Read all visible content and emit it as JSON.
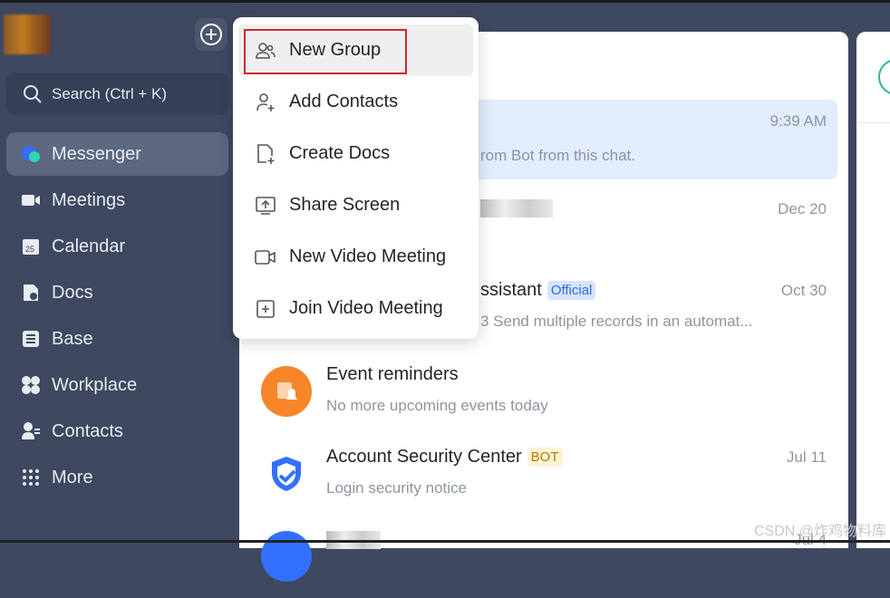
{
  "sidebar": {
    "search_placeholder": "Search (Ctrl + K)",
    "items": [
      {
        "label": "Messenger",
        "icon": "messenger-icon",
        "active": true
      },
      {
        "label": "Meetings",
        "icon": "video-icon"
      },
      {
        "label": "Calendar",
        "icon": "calendar-icon"
      },
      {
        "label": "Docs",
        "icon": "docs-icon"
      },
      {
        "label": "Base",
        "icon": "base-icon"
      },
      {
        "label": "Workplace",
        "icon": "workplace-icon"
      },
      {
        "label": "Contacts",
        "icon": "contacts-icon"
      },
      {
        "label": "More",
        "icon": "more-icon"
      }
    ]
  },
  "menu": {
    "items": [
      {
        "label": "New Group",
        "icon": "group-icon"
      },
      {
        "label": "Add Contacts",
        "icon": "add-contact-icon"
      },
      {
        "label": "Create Docs",
        "icon": "create-doc-icon"
      },
      {
        "label": "Share Screen",
        "icon": "share-screen-icon"
      },
      {
        "label": "New Video Meeting",
        "icon": "video-icon"
      },
      {
        "label": "Join Video Meeting",
        "icon": "join-icon"
      }
    ]
  },
  "chats": [
    {
      "title": "",
      "sub": "rom Bot from this chat.",
      "date": "9:39 AM"
    },
    {
      "title": "",
      "sub": "",
      "date": "Dec 20"
    },
    {
      "title": "ssistant",
      "badge": "Official",
      "sub": "3 Send multiple records in an automat...",
      "date": "Oct 30"
    },
    {
      "title": "Event reminders",
      "sub": "No more upcoming events today",
      "date": ""
    },
    {
      "title": "Account Security Center",
      "badge": "BOT",
      "sub": "Login security notice",
      "date": "Jul 11"
    },
    {
      "title": "",
      "sub": "",
      "date": "Jul 4"
    }
  ],
  "watermark": "CSDN @炸鸡物料库",
  "colors": {
    "sidebar": "#3e4860",
    "selected": "#e1ecfd",
    "highlight": "#d3262e"
  }
}
